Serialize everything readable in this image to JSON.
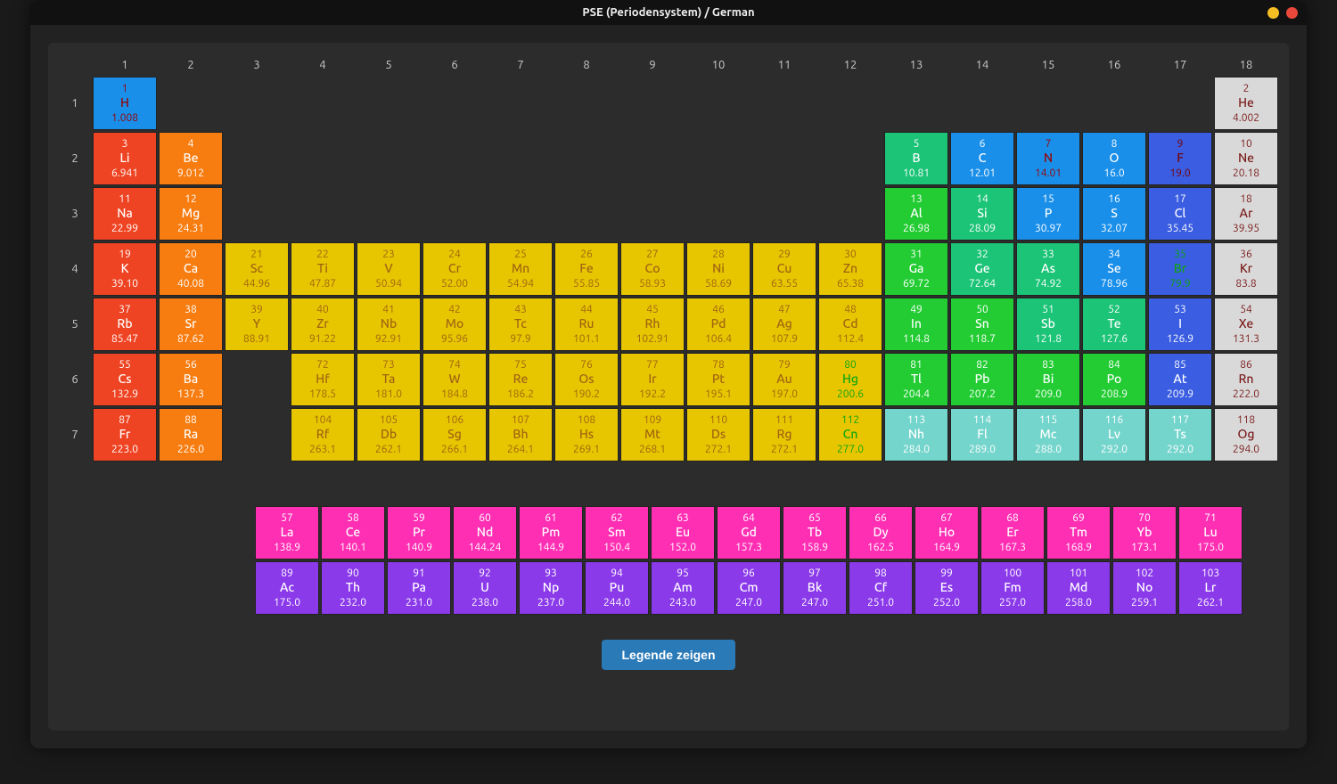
{
  "title": "PSE (Periodensystem) / German",
  "legend_button": "Legende zeigen",
  "groups": [
    "1",
    "2",
    "3",
    "4",
    "5",
    "6",
    "7",
    "8",
    "9",
    "10",
    "11",
    "12",
    "13",
    "14",
    "15",
    "16",
    "17",
    "18"
  ],
  "periods": [
    "1",
    "2",
    "3",
    "4",
    "5",
    "6",
    "7"
  ],
  "elements": [
    {
      "z": 1,
      "sym": "H",
      "mass": "1.008",
      "period": 1,
      "group": 1,
      "cls": "c-nonhydro"
    },
    {
      "z": 2,
      "sym": "He",
      "mass": "4.002",
      "period": 1,
      "group": 18,
      "cls": "c-noble"
    },
    {
      "z": 3,
      "sym": "Li",
      "mass": "6.941",
      "period": 2,
      "group": 1,
      "cls": "c-alkali"
    },
    {
      "z": 4,
      "sym": "Be",
      "mass": "9.012",
      "period": 2,
      "group": 2,
      "cls": "c-alkearth"
    },
    {
      "z": 5,
      "sym": "B",
      "mass": "10.81",
      "period": 2,
      "group": 13,
      "cls": "c-metalloid"
    },
    {
      "z": 6,
      "sym": "C",
      "mass": "12.01",
      "period": 2,
      "group": 14,
      "cls": "c-nonmetal"
    },
    {
      "z": 7,
      "sym": "N",
      "mass": "14.01",
      "period": 2,
      "group": 15,
      "cls": "c-nonhydro"
    },
    {
      "z": 8,
      "sym": "O",
      "mass": "16.0",
      "period": 2,
      "group": 16,
      "cls": "c-nonmetal"
    },
    {
      "z": 9,
      "sym": "F",
      "mass": "19.0",
      "period": 2,
      "group": 17,
      "cls": "c-halogenF"
    },
    {
      "z": 10,
      "sym": "Ne",
      "mass": "20.18",
      "period": 2,
      "group": 18,
      "cls": "c-noble"
    },
    {
      "z": 11,
      "sym": "Na",
      "mass": "22.99",
      "period": 3,
      "group": 1,
      "cls": "c-alkali"
    },
    {
      "z": 12,
      "sym": "Mg",
      "mass": "24.31",
      "period": 3,
      "group": 2,
      "cls": "c-alkearth"
    },
    {
      "z": 13,
      "sym": "Al",
      "mass": "26.98",
      "period": 3,
      "group": 13,
      "cls": "c-post"
    },
    {
      "z": 14,
      "sym": "Si",
      "mass": "28.09",
      "period": 3,
      "group": 14,
      "cls": "c-metalloid"
    },
    {
      "z": 15,
      "sym": "P",
      "mass": "30.97",
      "period": 3,
      "group": 15,
      "cls": "c-nonmetal"
    },
    {
      "z": 16,
      "sym": "S",
      "mass": "32.07",
      "period": 3,
      "group": 16,
      "cls": "c-nonmetal"
    },
    {
      "z": 17,
      "sym": "Cl",
      "mass": "35.45",
      "period": 3,
      "group": 17,
      "cls": "c-halogen"
    },
    {
      "z": 18,
      "sym": "Ar",
      "mass": "39.95",
      "period": 3,
      "group": 18,
      "cls": "c-noble"
    },
    {
      "z": 19,
      "sym": "K",
      "mass": "39.10",
      "period": 4,
      "group": 1,
      "cls": "c-alkali"
    },
    {
      "z": 20,
      "sym": "Ca",
      "mass": "40.08",
      "period": 4,
      "group": 2,
      "cls": "c-alkearth"
    },
    {
      "z": 21,
      "sym": "Sc",
      "mass": "44.96",
      "period": 4,
      "group": 3,
      "cls": "c-trans"
    },
    {
      "z": 22,
      "sym": "Ti",
      "mass": "47.87",
      "period": 4,
      "group": 4,
      "cls": "c-trans"
    },
    {
      "z": 23,
      "sym": "V",
      "mass": "50.94",
      "period": 4,
      "group": 5,
      "cls": "c-trans"
    },
    {
      "z": 24,
      "sym": "Cr",
      "mass": "52.00",
      "period": 4,
      "group": 6,
      "cls": "c-trans"
    },
    {
      "z": 25,
      "sym": "Mn",
      "mass": "54.94",
      "period": 4,
      "group": 7,
      "cls": "c-trans"
    },
    {
      "z": 26,
      "sym": "Fe",
      "mass": "55.85",
      "period": 4,
      "group": 8,
      "cls": "c-trans"
    },
    {
      "z": 27,
      "sym": "Co",
      "mass": "58.93",
      "period": 4,
      "group": 9,
      "cls": "c-trans"
    },
    {
      "z": 28,
      "sym": "Ni",
      "mass": "58.69",
      "period": 4,
      "group": 10,
      "cls": "c-trans"
    },
    {
      "z": 29,
      "sym": "Cu",
      "mass": "63.55",
      "period": 4,
      "group": 11,
      "cls": "c-trans"
    },
    {
      "z": 30,
      "sym": "Zn",
      "mass": "65.38",
      "period": 4,
      "group": 12,
      "cls": "c-trans"
    },
    {
      "z": 31,
      "sym": "Ga",
      "mass": "69.72",
      "period": 4,
      "group": 13,
      "cls": "c-post"
    },
    {
      "z": 32,
      "sym": "Ge",
      "mass": "72.64",
      "period": 4,
      "group": 14,
      "cls": "c-metalloid"
    },
    {
      "z": 33,
      "sym": "As",
      "mass": "74.92",
      "period": 4,
      "group": 15,
      "cls": "c-metalloid"
    },
    {
      "z": 34,
      "sym": "Se",
      "mass": "78.96",
      "period": 4,
      "group": 16,
      "cls": "c-nonmetal"
    },
    {
      "z": 35,
      "sym": "Br",
      "mass": "79.9",
      "period": 4,
      "group": 17,
      "cls": "c-br"
    },
    {
      "z": 36,
      "sym": "Kr",
      "mass": "83.8",
      "period": 4,
      "group": 18,
      "cls": "c-noble"
    },
    {
      "z": 37,
      "sym": "Rb",
      "mass": "85.47",
      "period": 5,
      "group": 1,
      "cls": "c-alkali"
    },
    {
      "z": 38,
      "sym": "Sr",
      "mass": "87.62",
      "period": 5,
      "group": 2,
      "cls": "c-alkearth"
    },
    {
      "z": 39,
      "sym": "Y",
      "mass": "88.91",
      "period": 5,
      "group": 3,
      "cls": "c-trans"
    },
    {
      "z": 40,
      "sym": "Zr",
      "mass": "91.22",
      "period": 5,
      "group": 4,
      "cls": "c-trans"
    },
    {
      "z": 41,
      "sym": "Nb",
      "mass": "92.91",
      "period": 5,
      "group": 5,
      "cls": "c-trans"
    },
    {
      "z": 42,
      "sym": "Mo",
      "mass": "95.96",
      "period": 5,
      "group": 6,
      "cls": "c-trans"
    },
    {
      "z": 43,
      "sym": "Tc",
      "mass": "97.9",
      "period": 5,
      "group": 7,
      "cls": "c-trans"
    },
    {
      "z": 44,
      "sym": "Ru",
      "mass": "101.1",
      "period": 5,
      "group": 8,
      "cls": "c-trans"
    },
    {
      "z": 45,
      "sym": "Rh",
      "mass": "102.91",
      "period": 5,
      "group": 9,
      "cls": "c-trans"
    },
    {
      "z": 46,
      "sym": "Pd",
      "mass": "106.4",
      "period": 5,
      "group": 10,
      "cls": "c-trans"
    },
    {
      "z": 47,
      "sym": "Ag",
      "mass": "107.9",
      "period": 5,
      "group": 11,
      "cls": "c-trans"
    },
    {
      "z": 48,
      "sym": "Cd",
      "mass": "112.4",
      "period": 5,
      "group": 12,
      "cls": "c-trans"
    },
    {
      "z": 49,
      "sym": "In",
      "mass": "114.8",
      "period": 5,
      "group": 13,
      "cls": "c-post"
    },
    {
      "z": 50,
      "sym": "Sn",
      "mass": "118.7",
      "period": 5,
      "group": 14,
      "cls": "c-post"
    },
    {
      "z": 51,
      "sym": "Sb",
      "mass": "121.8",
      "period": 5,
      "group": 15,
      "cls": "c-metalloid"
    },
    {
      "z": 52,
      "sym": "Te",
      "mass": "127.6",
      "period": 5,
      "group": 16,
      "cls": "c-metalloid"
    },
    {
      "z": 53,
      "sym": "I",
      "mass": "126.9",
      "period": 5,
      "group": 17,
      "cls": "c-halogen"
    },
    {
      "z": 54,
      "sym": "Xe",
      "mass": "131.3",
      "period": 5,
      "group": 18,
      "cls": "c-noble"
    },
    {
      "z": 55,
      "sym": "Cs",
      "mass": "132.9",
      "period": 6,
      "group": 1,
      "cls": "c-alkali"
    },
    {
      "z": 56,
      "sym": "Ba",
      "mass": "137.3",
      "period": 6,
      "group": 2,
      "cls": "c-alkearth"
    },
    {
      "z": 72,
      "sym": "Hf",
      "mass": "178.5",
      "period": 6,
      "group": 4,
      "cls": "c-trans"
    },
    {
      "z": 73,
      "sym": "Ta",
      "mass": "181.0",
      "period": 6,
      "group": 5,
      "cls": "c-trans"
    },
    {
      "z": 74,
      "sym": "W",
      "mass": "184.8",
      "period": 6,
      "group": 6,
      "cls": "c-trans"
    },
    {
      "z": 75,
      "sym": "Re",
      "mass": "186.2",
      "period": 6,
      "group": 7,
      "cls": "c-trans"
    },
    {
      "z": 76,
      "sym": "Os",
      "mass": "190.2",
      "period": 6,
      "group": 8,
      "cls": "c-trans"
    },
    {
      "z": 77,
      "sym": "Ir",
      "mass": "192.2",
      "period": 6,
      "group": 9,
      "cls": "c-trans"
    },
    {
      "z": 78,
      "sym": "Pt",
      "mass": "195.1",
      "period": 6,
      "group": 10,
      "cls": "c-trans"
    },
    {
      "z": 79,
      "sym": "Au",
      "mass": "197.0",
      "period": 6,
      "group": 11,
      "cls": "c-trans"
    },
    {
      "z": 80,
      "sym": "Hg",
      "mass": "200.6",
      "period": 6,
      "group": 12,
      "cls": "c-hg"
    },
    {
      "z": 81,
      "sym": "Tl",
      "mass": "204.4",
      "period": 6,
      "group": 13,
      "cls": "c-post"
    },
    {
      "z": 82,
      "sym": "Pb",
      "mass": "207.2",
      "period": 6,
      "group": 14,
      "cls": "c-post"
    },
    {
      "z": 83,
      "sym": "Bi",
      "mass": "209.0",
      "period": 6,
      "group": 15,
      "cls": "c-post"
    },
    {
      "z": 84,
      "sym": "Po",
      "mass": "208.9",
      "period": 6,
      "group": 16,
      "cls": "c-post"
    },
    {
      "z": 85,
      "sym": "At",
      "mass": "209.9",
      "period": 6,
      "group": 17,
      "cls": "c-halogen"
    },
    {
      "z": 86,
      "sym": "Rn",
      "mass": "222.0",
      "period": 6,
      "group": 18,
      "cls": "c-noble"
    },
    {
      "z": 87,
      "sym": "Fr",
      "mass": "223.0",
      "period": 7,
      "group": 1,
      "cls": "c-alkali"
    },
    {
      "z": 88,
      "sym": "Ra",
      "mass": "226.0",
      "period": 7,
      "group": 2,
      "cls": "c-alkearth"
    },
    {
      "z": 104,
      "sym": "Rf",
      "mass": "263.1",
      "period": 7,
      "group": 4,
      "cls": "c-trans"
    },
    {
      "z": 105,
      "sym": "Db",
      "mass": "262.1",
      "period": 7,
      "group": 5,
      "cls": "c-trans"
    },
    {
      "z": 106,
      "sym": "Sg",
      "mass": "266.1",
      "period": 7,
      "group": 6,
      "cls": "c-trans"
    },
    {
      "z": 107,
      "sym": "Bh",
      "mass": "264.1",
      "period": 7,
      "group": 7,
      "cls": "c-trans"
    },
    {
      "z": 108,
      "sym": "Hs",
      "mass": "269.1",
      "period": 7,
      "group": 8,
      "cls": "c-trans"
    },
    {
      "z": 109,
      "sym": "Mt",
      "mass": "268.1",
      "period": 7,
      "group": 9,
      "cls": "c-trans"
    },
    {
      "z": 110,
      "sym": "Ds",
      "mass": "272.1",
      "period": 7,
      "group": 10,
      "cls": "c-trans"
    },
    {
      "z": 111,
      "sym": "Rg",
      "mass": "272.1",
      "period": 7,
      "group": 11,
      "cls": "c-trans"
    },
    {
      "z": 112,
      "sym": "Cn",
      "mass": "277.0",
      "period": 7,
      "group": 12,
      "cls": "c-hg"
    },
    {
      "z": 113,
      "sym": "Nh",
      "mass": "284.0",
      "period": 7,
      "group": 13,
      "cls": "c-othpost"
    },
    {
      "z": 114,
      "sym": "Fl",
      "mass": "289.0",
      "period": 7,
      "group": 14,
      "cls": "c-othpost"
    },
    {
      "z": 115,
      "sym": "Mc",
      "mass": "288.0",
      "period": 7,
      "group": 15,
      "cls": "c-othpost"
    },
    {
      "z": 116,
      "sym": "Lv",
      "mass": "292.0",
      "period": 7,
      "group": 16,
      "cls": "c-othpost"
    },
    {
      "z": 117,
      "sym": "Ts",
      "mass": "292.0",
      "period": 7,
      "group": 17,
      "cls": "c-othpost"
    },
    {
      "z": 118,
      "sym": "Og",
      "mass": "294.0",
      "period": 7,
      "group": 18,
      "cls": "c-noble"
    }
  ],
  "lanthanides": [
    {
      "z": 57,
      "sym": "La",
      "mass": "138.9",
      "cls": "c-lanth"
    },
    {
      "z": 58,
      "sym": "Ce",
      "mass": "140.1",
      "cls": "c-lanth"
    },
    {
      "z": 59,
      "sym": "Pr",
      "mass": "140.9",
      "cls": "c-lanth"
    },
    {
      "z": 60,
      "sym": "Nd",
      "mass": "144.24",
      "cls": "c-lanth"
    },
    {
      "z": 61,
      "sym": "Pm",
      "mass": "144.9",
      "cls": "c-lanth"
    },
    {
      "z": 62,
      "sym": "Sm",
      "mass": "150.4",
      "cls": "c-lanth"
    },
    {
      "z": 63,
      "sym": "Eu",
      "mass": "152.0",
      "cls": "c-lanth"
    },
    {
      "z": 64,
      "sym": "Gd",
      "mass": "157.3",
      "cls": "c-lanth"
    },
    {
      "z": 65,
      "sym": "Tb",
      "mass": "158.9",
      "cls": "c-lanth"
    },
    {
      "z": 66,
      "sym": "Dy",
      "mass": "162.5",
      "cls": "c-lanth"
    },
    {
      "z": 67,
      "sym": "Ho",
      "mass": "164.9",
      "cls": "c-lanth"
    },
    {
      "z": 68,
      "sym": "Er",
      "mass": "167.3",
      "cls": "c-lanth"
    },
    {
      "z": 69,
      "sym": "Tm",
      "mass": "168.9",
      "cls": "c-lanth"
    },
    {
      "z": 70,
      "sym": "Yb",
      "mass": "173.1",
      "cls": "c-lanth"
    },
    {
      "z": 71,
      "sym": "Lu",
      "mass": "175.0",
      "cls": "c-lanth"
    }
  ],
  "actinides": [
    {
      "z": 89,
      "sym": "Ac",
      "mass": "175.0",
      "cls": "c-actin"
    },
    {
      "z": 90,
      "sym": "Th",
      "mass": "232.0",
      "cls": "c-actin"
    },
    {
      "z": 91,
      "sym": "Pa",
      "mass": "231.0",
      "cls": "c-actin"
    },
    {
      "z": 92,
      "sym": "U",
      "mass": "238.0",
      "cls": "c-actin"
    },
    {
      "z": 93,
      "sym": "Np",
      "mass": "237.0",
      "cls": "c-actin"
    },
    {
      "z": 94,
      "sym": "Pu",
      "mass": "244.0",
      "cls": "c-actin"
    },
    {
      "z": 95,
      "sym": "Am",
      "mass": "243.0",
      "cls": "c-actin"
    },
    {
      "z": 96,
      "sym": "Cm",
      "mass": "247.0",
      "cls": "c-actin"
    },
    {
      "z": 97,
      "sym": "Bk",
      "mass": "247.0",
      "cls": "c-actin"
    },
    {
      "z": 98,
      "sym": "Cf",
      "mass": "251.0",
      "cls": "c-actin"
    },
    {
      "z": 99,
      "sym": "Es",
      "mass": "252.0",
      "cls": "c-actin"
    },
    {
      "z": 100,
      "sym": "Fm",
      "mass": "257.0",
      "cls": "c-actin"
    },
    {
      "z": 101,
      "sym": "Md",
      "mass": "258.0",
      "cls": "c-actin"
    },
    {
      "z": 102,
      "sym": "No",
      "mass": "259.1",
      "cls": "c-actin"
    },
    {
      "z": 103,
      "sym": "Lr",
      "mass": "262.1",
      "cls": "c-actin"
    }
  ]
}
